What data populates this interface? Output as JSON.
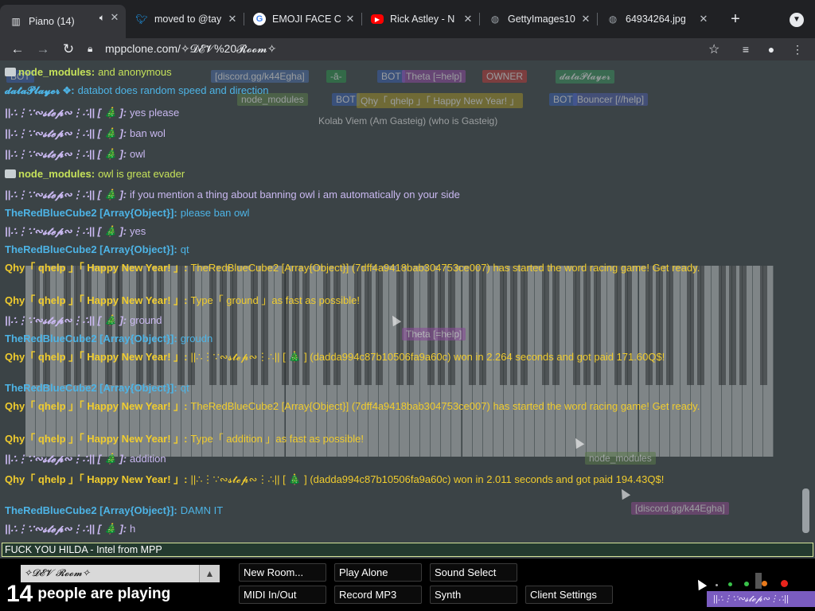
{
  "browser": {
    "tabs": [
      {
        "title": "Piano (14)",
        "icon": "piano-icon",
        "active": true
      },
      {
        "title": "moved to @tay",
        "icon": "twitter-icon"
      },
      {
        "title": "EMOJI FACE C",
        "icon": "google-icon"
      },
      {
        "title": "Rick Astley - N",
        "icon": "youtube-icon"
      },
      {
        "title": "GettyImages10",
        "icon": "globe-icon"
      },
      {
        "title": "64934264.jpg",
        "icon": "globe-icon"
      }
    ],
    "url": "mppclone.com/✧𝓓𝓔𝓥%20𝓡𝓸𝓸𝓶✧"
  },
  "chat": [
    {
      "name": "node_modules:",
      "text": "and anonymous",
      "style": "node",
      "folder": true
    },
    {
      "name": "𝓭𝓪𝓽𝓪𝓟𝓵𝓪𝔂𝓮𝓻 ❖:",
      "text": "databot does random speed and direction",
      "style": "cube"
    },
    {
      "name": "||∴⋮∵∾𝓼𝓽𝓮𝓹∾⋮∴|| [ 🎄 ]:",
      "text": "yes please",
      "style": "user"
    },
    {
      "name": "||∴⋮∵∾𝓼𝓽𝓮𝓹∾⋮∴|| [ 🎄 ]:",
      "text": "ban wol",
      "style": "user"
    },
    {
      "name": "||∴⋮∵∾𝓼𝓽𝓮𝓹∾⋮∴|| [ 🎄 ]:",
      "text": "owl",
      "style": "user"
    },
    {
      "name": "node_modules:",
      "text": "owl is great evader",
      "style": "node",
      "folder": true
    },
    {
      "name": "||∴⋮∵∾𝓼𝓽𝓮𝓹∾⋮∴|| [ 🎄 ]:",
      "text": "if you mention a thing about banning owl i am automatically on your side",
      "style": "user"
    },
    {
      "name": "TheRedBlueCube2 [Array{Object}]:",
      "text": "please ban owl",
      "style": "cube"
    },
    {
      "name": "||∴⋮∵∾𝓼𝓽𝓮𝓹∾⋮∴|| [ 🎄 ]:",
      "text": "yes",
      "style": "user"
    },
    {
      "name": "TheRedBlueCube2 [Array{Object}]:",
      "text": "qt",
      "style": "cube"
    },
    {
      "name": "Qhy「 qhelp 」「 Happy New Year! 」:",
      "text": "TheRedBlueCube2 [Array{Object}] (7dff4a9418bab304753ce007) has started the word racing game! Get ready.",
      "style": "qhy",
      "wrap": true
    },
    {
      "name": "Qhy「 qhelp 」「 Happy New Year! 」:",
      "text": "Type「 ground 」as fast as possible!",
      "style": "qhy"
    },
    {
      "name": "||∴⋮∵∾𝓼𝓽𝓮𝓹∾⋮∴|| [ 🎄 ]:",
      "text": "ground",
      "style": "user"
    },
    {
      "name": "TheRedBlueCube2 [Array{Object}]:",
      "text": "groudn",
      "style": "cube"
    },
    {
      "name": "Qhy「 qhelp 」「 Happy New Year! 」:",
      "text": "||∴⋮∵∾𝓼𝓽𝓮𝓹∾⋮∴|| [ 🎄 ] (dadda994c87b10506fa9a60c) won in 2.264 seconds and got paid 171.60Q$!",
      "style": "qhy",
      "wrap": true
    },
    {
      "name": "TheRedBlueCube2 [Array{Object}]:",
      "text": "qt",
      "style": "cube"
    },
    {
      "name": "Qhy「 qhelp 」「 Happy New Year! 」:",
      "text": "TheRedBlueCube2 [Array{Object}] (7dff4a9418bab304753ce007) has started the word racing game! Get ready.",
      "style": "qhy",
      "wrap": true
    },
    {
      "name": "Qhy「 qhelp 」「 Happy New Year! 」:",
      "text": "Type「 addition 」as fast as possible!",
      "style": "qhy"
    },
    {
      "name": "||∴⋮∵∾𝓼𝓽𝓮𝓹∾⋮∴|| [ 🎄 ]:",
      "text": "addition",
      "style": "user"
    },
    {
      "name": "Qhy「 qhelp 」「 Happy New Year! 」:",
      "text": "||∴⋮∵∾𝓼𝓽𝓮𝓹∾⋮∴|| [ 🎄 ] (dadda994c87b10506fa9a60c) won in 2.011 seconds and got paid 194.43Q$!",
      "style": "qhy",
      "wrap": true
    },
    {
      "name": "TheRedBlueCube2 [Array{Object}]:",
      "text": "DAMN IT",
      "style": "cube"
    },
    {
      "name": "||∴⋮∵∾𝓼𝓽𝓮𝓹∾⋮∴|| [ 🎄 ]:",
      "text": "h",
      "style": "user"
    }
  ],
  "ghost_tags": [
    {
      "text": "BOT",
      "color": "#3a5ea8"
    },
    {
      "text": "[discord.gg/k44Egha]",
      "color": "#4a6aa0"
    },
    {
      "text": "-ā-",
      "color": "#2d8a4b"
    },
    {
      "text": "BOT",
      "color": "#3a5ea8"
    },
    {
      "text": "Theta [=help]",
      "color": "#8a4a9a"
    },
    {
      "text": "OWNER",
      "color": "#b23a3a"
    },
    {
      "text": "𝓭𝓪𝓽𝓪𝓟𝓵𝓪𝔂𝓮𝓻",
      "color": "#3a8a5a"
    },
    {
      "text": "node_modules",
      "color": "#5a7a4a"
    },
    {
      "text": "BOT",
      "color": "#3a5ea8"
    },
    {
      "text": "Qhy「 qhelp 」「 Happy New Year! 」",
      "color": "#9a8a2a"
    },
    {
      "text": "BOT",
      "color": "#3a5ea8"
    },
    {
      "text": "Bouncer [//help]",
      "color": "#4a5aa0"
    },
    {
      "text": "Kolab Viem (Am Gasteig) (who is Gasteig)",
      "color": "#3b4346"
    },
    {
      "text": "Theta [=help]",
      "color": "#8a4a9a"
    },
    {
      "text": "node_modules",
      "color": "#5a7a4a"
    },
    {
      "text": "[discord.gg/k44Egha]",
      "color": "#8a4a8a"
    }
  ],
  "input": {
    "value": "FUCK YOU HILDA - Intel from MPP"
  },
  "room": {
    "name": "✧𝓓𝓔𝓥 𝓡𝓸𝓸𝓶✧",
    "count": "14",
    "count_text": "people are playing"
  },
  "buttons": {
    "new_room": "New Room...",
    "play_alone": "Play Alone",
    "sound_select": "Sound Select",
    "midi": "MIDI In/Out",
    "record": "Record MP3",
    "synth": "Synth",
    "client_settings": "Client Settings"
  },
  "user_tag": "||∴⋮∵∾𝓼𝓽𝓮𝓹∾⋮∴||",
  "colors": {
    "node": "#c6e25a",
    "cube": "#4db4e6",
    "qhy": "#f0cc2e",
    "user": "#c9b8f0"
  }
}
